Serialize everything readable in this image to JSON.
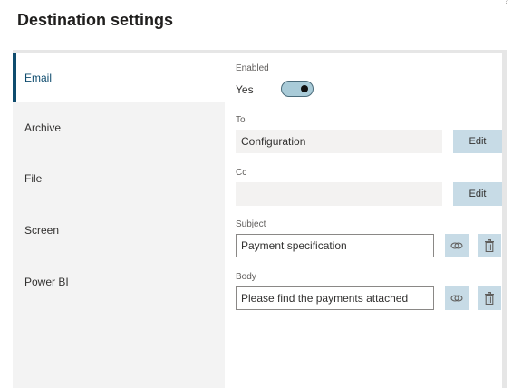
{
  "page": {
    "title": "Destination settings",
    "help_glyph": "?"
  },
  "nav": {
    "items": [
      {
        "label": "Email",
        "active": true
      },
      {
        "label": "Archive",
        "active": false
      },
      {
        "label": "File",
        "active": false
      },
      {
        "label": "Screen",
        "active": false
      },
      {
        "label": "Power BI",
        "active": false
      }
    ]
  },
  "form": {
    "enabled": {
      "label": "Enabled",
      "value_text": "Yes",
      "on": true
    },
    "to": {
      "label": "To",
      "value": "Configuration",
      "button": "Edit"
    },
    "cc": {
      "label": "Cc",
      "value": "",
      "button": "Edit"
    },
    "subject": {
      "label": "Subject",
      "value": "Payment specification",
      "icons": [
        "link-icon",
        "delete-icon"
      ]
    },
    "body": {
      "label": "Body",
      "value": "Please find the payments attached",
      "icons": [
        "link-icon",
        "delete-icon"
      ]
    }
  },
  "colors": {
    "accent": "#0f4c6e",
    "button_bg": "#c7dbe6",
    "toggle_bg": "#a9cbd8"
  }
}
